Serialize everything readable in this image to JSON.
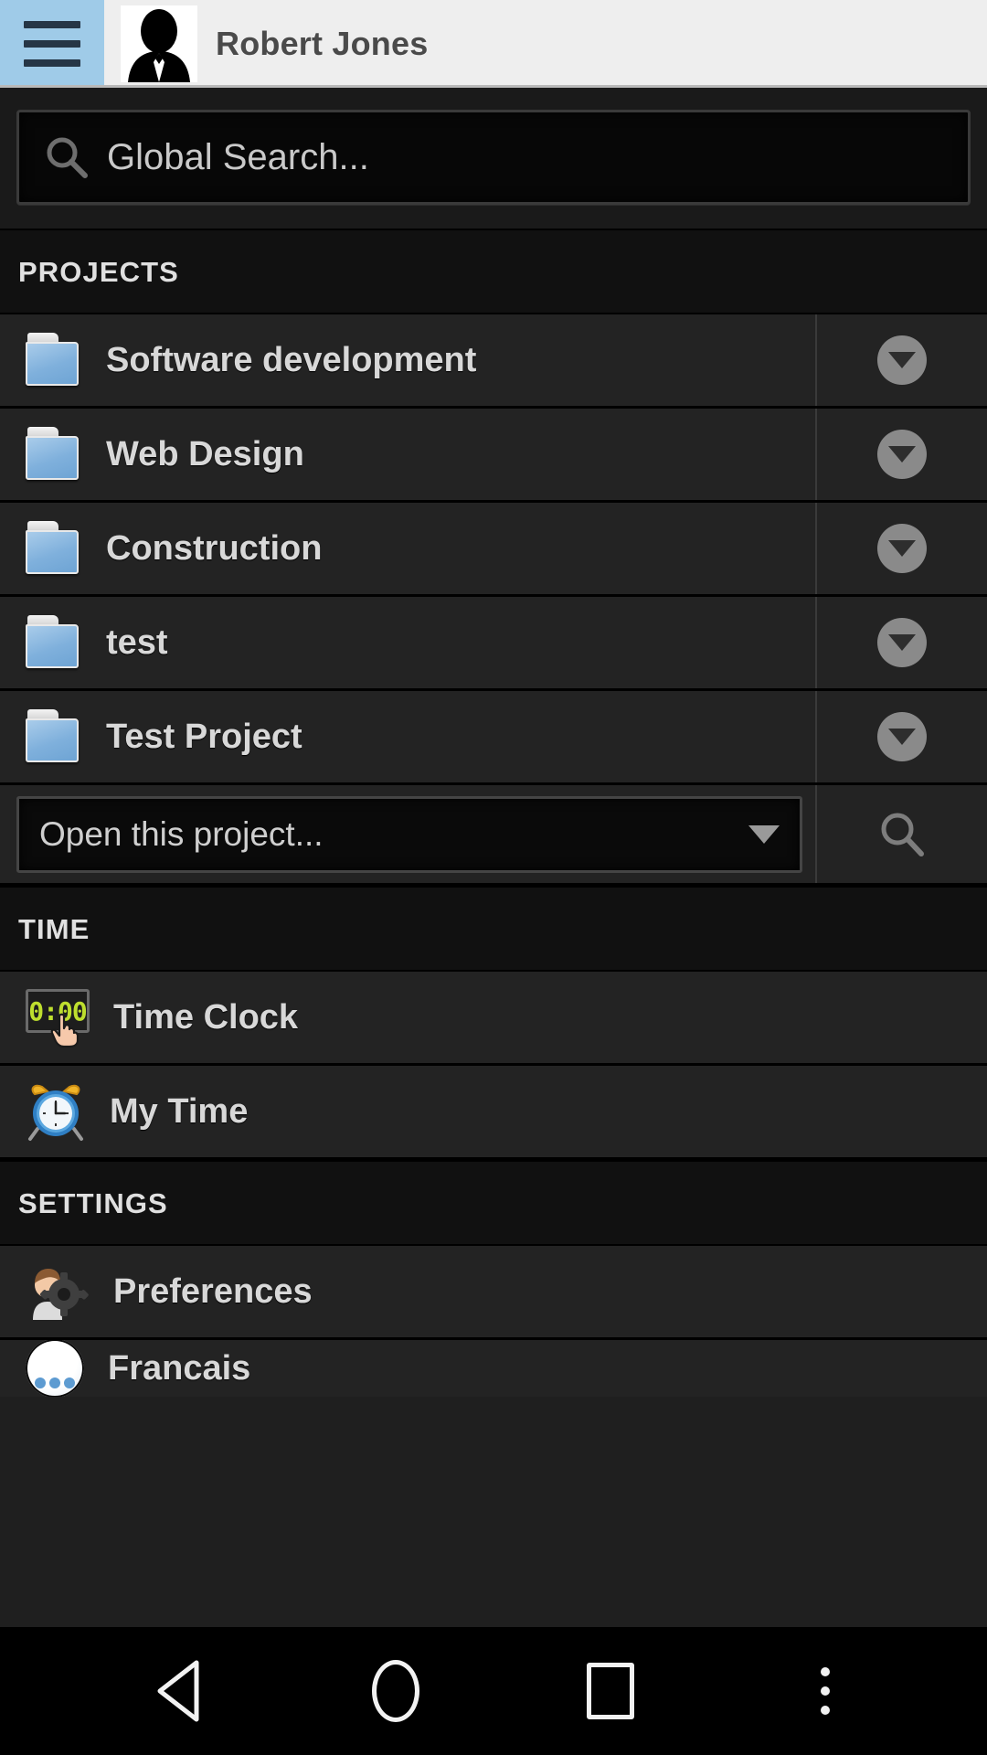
{
  "header": {
    "menu_icon": "hamburger-menu-icon",
    "avatar_icon": "user-avatar-silhouette",
    "user_name": "Robert Jones",
    "menu_accent_color": "#9fcbe8",
    "background_color": "#eeeeee"
  },
  "search": {
    "icon": "search-icon",
    "placeholder": "Global Search...",
    "value": ""
  },
  "sections": {
    "projects": {
      "title": "PROJECTS",
      "items": [
        {
          "label": "Software development",
          "icon": "folder-icon",
          "expander": "chevron-down-icon"
        },
        {
          "label": "Web Design",
          "icon": "folder-icon",
          "expander": "chevron-down-icon"
        },
        {
          "label": "Construction",
          "icon": "folder-icon",
          "expander": "chevron-down-icon"
        },
        {
          "label": "test",
          "icon": "folder-icon",
          "expander": "chevron-down-icon"
        },
        {
          "label": "Test Project",
          "icon": "folder-icon",
          "expander": "chevron-down-icon"
        }
      ],
      "project_picker": {
        "selected": "Open this project...",
        "caret_icon": "caret-down-icon",
        "search_icon": "search-icon"
      }
    },
    "time": {
      "title": "TIME",
      "items": [
        {
          "label": "Time Clock",
          "icon": "digital-clock-icon",
          "icon_value": "0:00"
        },
        {
          "label": "My Time",
          "icon": "alarm-clock-icon"
        }
      ]
    },
    "settings": {
      "title": "SETTINGS",
      "items": [
        {
          "label": "Preferences",
          "icon": "user-gear-icon"
        },
        {
          "label": "Francais",
          "icon": "language-globe-icon"
        }
      ]
    }
  },
  "navbar": {
    "back_label": "Back",
    "home_label": "Home",
    "recents_label": "Recents",
    "more_label": "More options"
  },
  "colors": {
    "accent": "#9fcbe8",
    "row_bg": "#232323",
    "section_bg": "#111111",
    "text": "#d8d8d8"
  }
}
